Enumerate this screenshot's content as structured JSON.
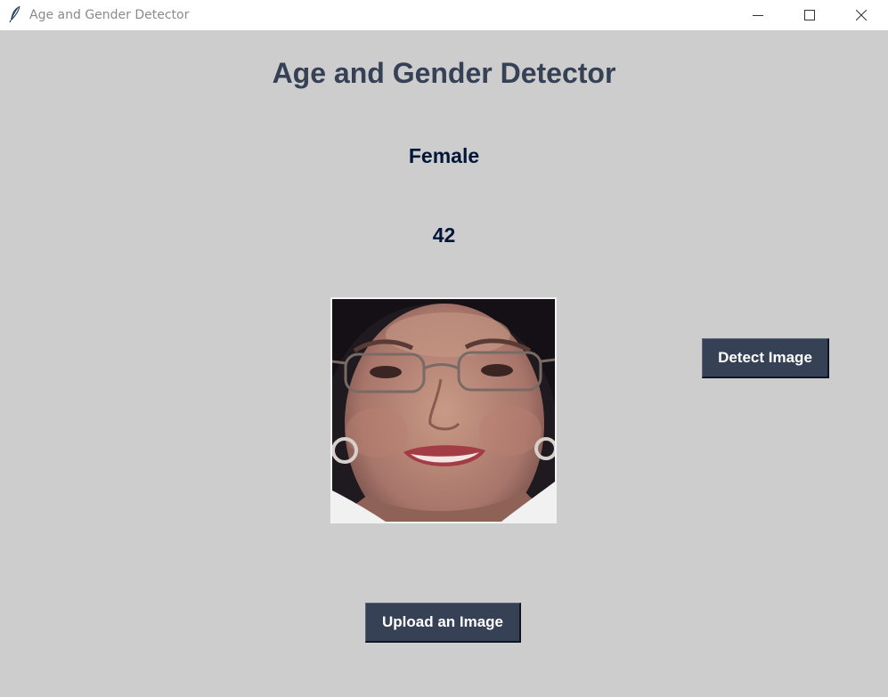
{
  "window": {
    "title": "Age and Gender Detector",
    "icon": "feather-icon"
  },
  "titlebar_controls": {
    "minimize_icon": "minimize-icon",
    "maximize_icon": "maximize-icon",
    "close_icon": "close-icon"
  },
  "main": {
    "heading": "Age and Gender Detector",
    "gender_result": "Female",
    "age_result": "42"
  },
  "buttons": {
    "detect_label": "Detect Image",
    "upload_label": "Upload an Image"
  },
  "colors": {
    "background": "#cdcdcd",
    "heading": "#364156",
    "result_text": "#011638",
    "button_bg": "#364156",
    "button_text": "#ffffff"
  }
}
